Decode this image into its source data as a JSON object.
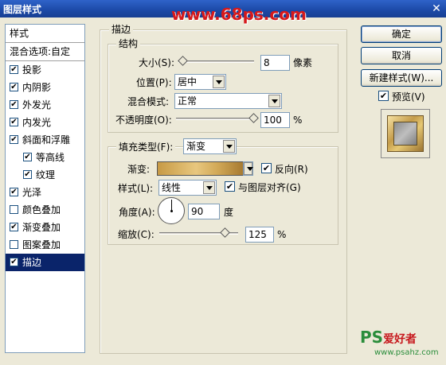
{
  "window": {
    "title": "图层样式",
    "close": "✕",
    "watermark": "www.68ps.com"
  },
  "styles": {
    "header": "样式",
    "blend": "混合选项:自定",
    "items": [
      {
        "label": "投影",
        "checked": true
      },
      {
        "label": "内阴影",
        "checked": true
      },
      {
        "label": "外发光",
        "checked": true
      },
      {
        "label": "内发光",
        "checked": true
      },
      {
        "label": "斜面和浮雕",
        "checked": true
      },
      {
        "label": "等高线",
        "checked": true
      },
      {
        "label": "纹理",
        "checked": true
      },
      {
        "label": "光泽",
        "checked": true
      },
      {
        "label": "颜色叠加",
        "checked": false
      },
      {
        "label": "渐变叠加",
        "checked": true
      },
      {
        "label": "图案叠加",
        "checked": false
      },
      {
        "label": "描边",
        "checked": true
      }
    ]
  },
  "stroke": {
    "group_title": "描边",
    "structure": {
      "title": "结构",
      "size_label": "大小(S):",
      "size_value": "8",
      "size_unit": "像素",
      "position_label": "位置(P):",
      "position_value": "居中",
      "blend_label": "混合模式:",
      "blend_value": "正常",
      "opacity_label": "不透明度(O):",
      "opacity_value": "100",
      "opacity_unit": "%"
    },
    "fill": {
      "fill_type_label": "填充类型(F):",
      "fill_type_value": "渐变",
      "gradient_label": "渐变:",
      "reverse_label": "反向(R)",
      "style_label": "样式(L):",
      "style_value": "线性",
      "align_label": "与图层对齐(G)",
      "angle_label": "角度(A):",
      "angle_value": "90",
      "angle_unit": "度",
      "scale_label": "缩放(C):",
      "scale_value": "125",
      "scale_unit": "%"
    }
  },
  "buttons": {
    "ok": "确定",
    "cancel": "取消",
    "new_style": "新建样式(W)...",
    "preview": "预览(V)"
  },
  "logo": {
    "ps": "PS",
    "zh": "爱好者",
    "url": "www.psahz.com"
  },
  "check_glyph": "✔"
}
